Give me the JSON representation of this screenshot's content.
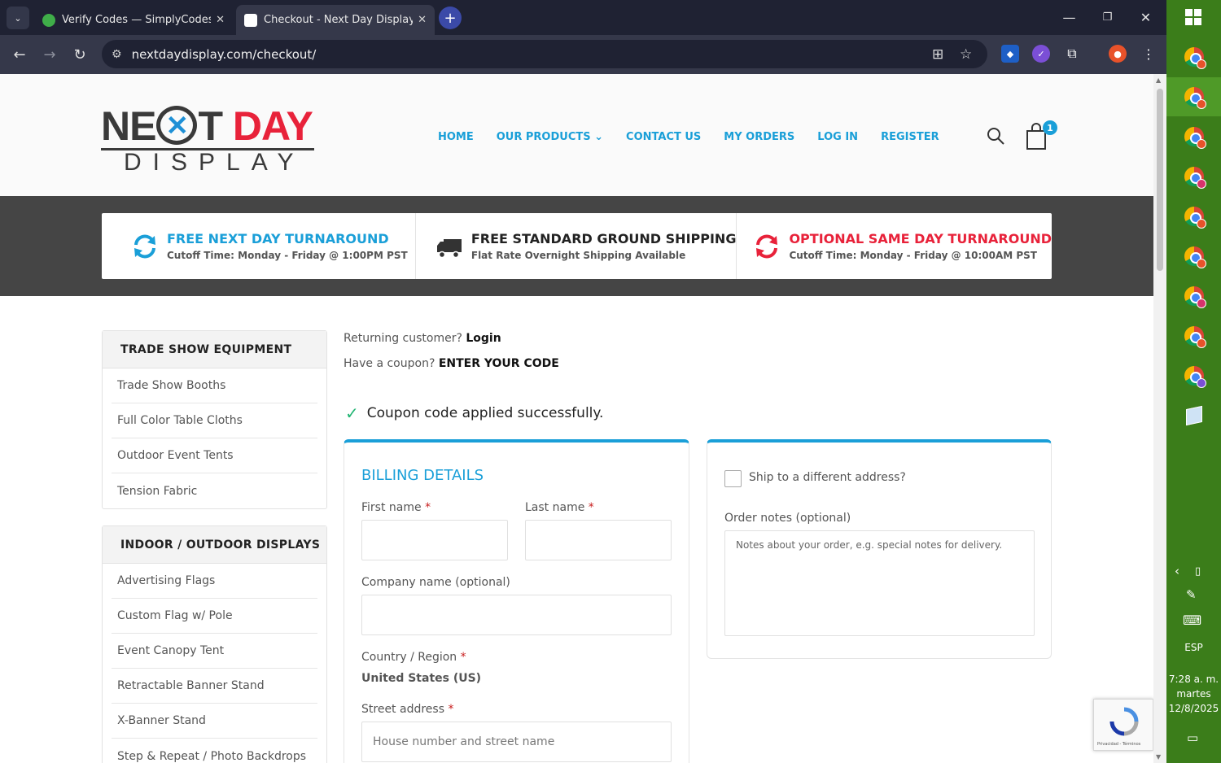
{
  "browser": {
    "tabs": [
      {
        "title": "Verify Codes — SimplyCodes",
        "active": false,
        "favicon_color": "#3fae49"
      },
      {
        "title": "Checkout - Next Day Display",
        "active": true,
        "favicon_color": "#ffffff"
      }
    ],
    "url": "nextdaydisplay.com/checkout/",
    "icons": [
      "tab-search-icon",
      "back-arrow-icon",
      "forward-arrow-icon",
      "reload-icon",
      "site-info-icon",
      "translate-icon",
      "bookmark-star-icon",
      "shield-extension-icon",
      "extension-icon",
      "puzzle-icon",
      "profile-icon",
      "kebab-menu-icon",
      "minimize-icon",
      "restore-icon",
      "close-icon",
      "new-tab-icon"
    ]
  },
  "site": {
    "logo": {
      "part1": "NE",
      "part2": "T",
      "part3": " DAY",
      "line2": "DISPLAY"
    },
    "nav": [
      "HOME",
      "OUR PRODUCTS",
      "CONTACT US",
      "MY ORDERS",
      "LOG IN",
      "REGISTER"
    ],
    "nav_dropdown_caret": "⌄",
    "cart_count": "1",
    "brand_blue": "#1a9fd8",
    "brand_red": "#e8223a"
  },
  "promos": [
    {
      "title": "FREE NEXT DAY TURNAROUND",
      "subtitle": "Cutoff Time: Monday - Friday @ 1:00PM PST",
      "color": "#1a9fd8",
      "icon": "refresh-icon"
    },
    {
      "title": "FREE STANDARD GROUND SHIPPING",
      "subtitle": "Flat Rate Overnight Shipping Available",
      "color": "#222222",
      "icon": "truck-icon"
    },
    {
      "title": "OPTIONAL SAME DAY TURNAROUND",
      "subtitle": "Cutoff Time: Monday - Friday @ 10:00AM PST",
      "color": "#e8223a",
      "icon": "refresh-icon"
    }
  ],
  "sidebar": {
    "groups": [
      {
        "heading": "TRADE SHOW EQUIPMENT",
        "items": [
          "Trade Show Booths",
          "Full Color Table Cloths",
          "Outdoor Event Tents",
          "Tension Fabric"
        ]
      },
      {
        "heading": "INDOOR / OUTDOOR DISPLAYS",
        "items": [
          "Advertising Flags",
          "Custom Flag w/ Pole",
          "Event Canopy Tent",
          "Retractable Banner Stand",
          "X-Banner Stand",
          "Step & Repeat / Photo Backdrops"
        ]
      }
    ]
  },
  "checkout": {
    "returning_text": "Returning customer?",
    "login_link": "Login",
    "coupon_text": "Have a coupon?",
    "coupon_link": "ENTER YOUR CODE",
    "success_message": "Coupon code applied successfully.",
    "billing": {
      "heading": "BILLING DETAILS",
      "first_name_label": "First name",
      "last_name_label": "Last name",
      "company_label": "Company name (optional)",
      "country_label": "Country / Region",
      "country_value": "United States (US)",
      "street_label": "Street address",
      "street_placeholder": "House number and street name",
      "required_mark": "*"
    },
    "shipping": {
      "ship_different_label": "Ship to a different address?",
      "order_notes_label": "Order notes (optional)",
      "order_notes_placeholder": "Notes about your order, e.g. special notes for delivery."
    }
  },
  "recaptcha": {
    "footer": "Privacidad - Términos"
  },
  "taskbar": {
    "language": "ESP",
    "time": "7:28 a. m.",
    "day": "martes",
    "date": "12/8/2025",
    "app_count": 9
  }
}
